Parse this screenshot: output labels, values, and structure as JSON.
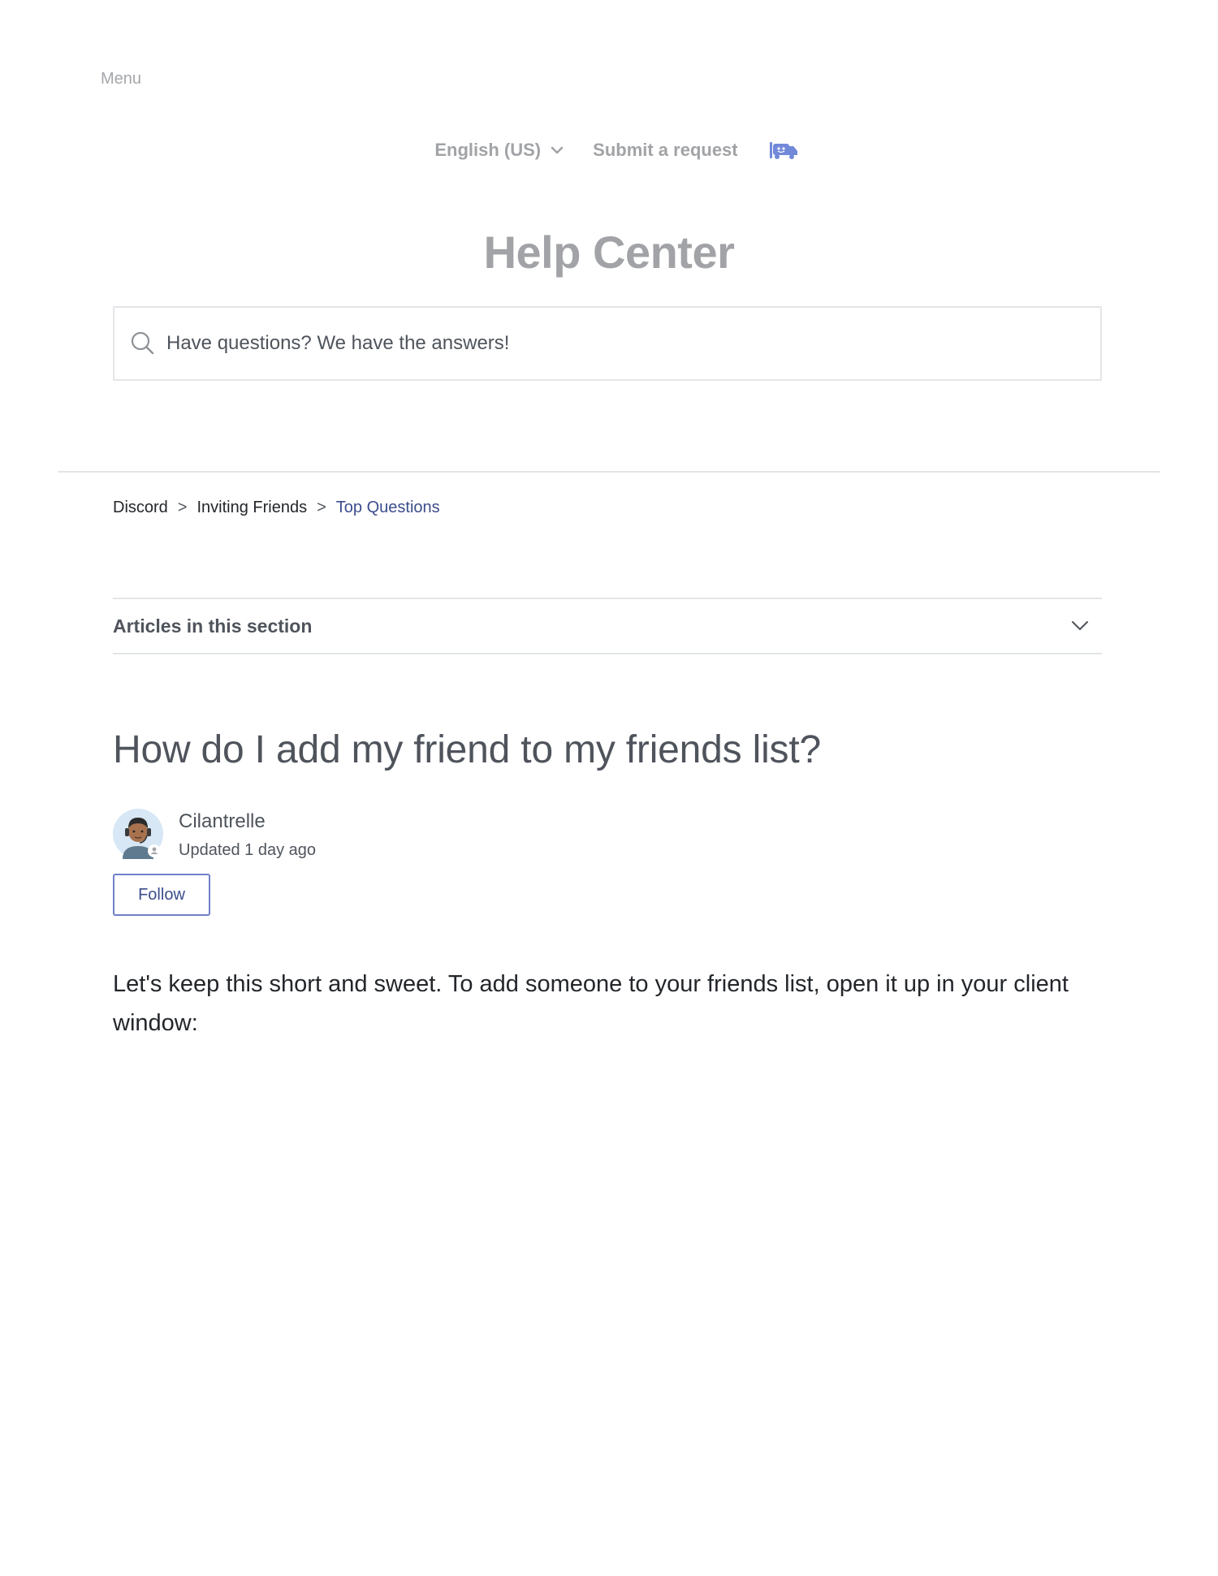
{
  "header": {
    "menu_label": "Menu",
    "language_label": "English (US)",
    "submit_request_label": "Submit a request",
    "logo_icon": "discord-logo-icon",
    "title": "Help Center"
  },
  "search": {
    "placeholder": "Have questions? We have the answers!",
    "icon": "search-icon"
  },
  "breadcrumbs": {
    "items": [
      "Discord",
      "Inviting Friends",
      "Top Questions"
    ],
    "separator": ">"
  },
  "section": {
    "label": "Articles in this section",
    "icon": "chevron-down-icon"
  },
  "article": {
    "title": "How do I add my friend to my friends list?",
    "author_name": "Cilantrelle",
    "updated": "Updated 1 day ago",
    "follow_label": "Follow",
    "body": "Let's keep this short and sweet. To add someone to your friends list, open it up in your client window:"
  },
  "colors": {
    "accent": "#7289da",
    "link": "#3b4d8c",
    "muted": "#a1a3a6",
    "border": "#e3e5e8"
  }
}
